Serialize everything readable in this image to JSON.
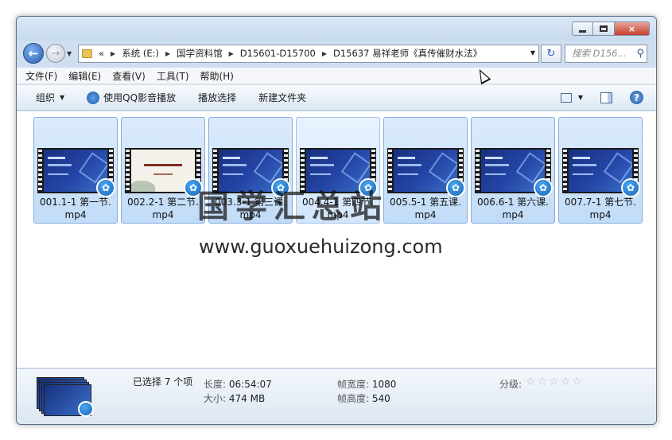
{
  "window": {
    "controls": {
      "minimize": "",
      "maximize": "",
      "close": "×"
    }
  },
  "nav": {
    "breadcrumb_prefix": "«",
    "breadcrumbs": [
      "系统 (E:)",
      "国学资料馆",
      "D15601-D15700",
      "D15637 易祥老师《真传催财水法》"
    ],
    "search_placeholder": "搜索 D156..."
  },
  "menu": [
    "文件(F)",
    "编辑(E)",
    "查看(V)",
    "工具(T)",
    "帮助(H)"
  ],
  "toolbar": {
    "organize": "组织",
    "play_qq": "使用QQ影音播放",
    "play_selection": "播放选择",
    "new_folder": "新建文件夹"
  },
  "files": [
    {
      "name": "001.1-1 第一节.mp4",
      "line1": "001.1-1 第一节.",
      "line2": "mp4",
      "thumb": "blue"
    },
    {
      "name": "002.2-1 第二节.mp4",
      "line1": "002.2-1 第二节.",
      "line2": "mp4",
      "thumb": "slide"
    },
    {
      "name": "003.3-1 第三课.mp4",
      "line1": "003.3-1 第三课.",
      "line2": "mp4",
      "thumb": "blue"
    },
    {
      "name": "004.4-1 第四节.mp4",
      "line1": "004.4-1 第四节.",
      "line2": "mp4",
      "thumb": "blue"
    },
    {
      "name": "005.5-1 第五课.mp4",
      "line1": "005.5-1 第五课.",
      "line2": "mp4",
      "thumb": "blue"
    },
    {
      "name": "006.6-1 第六课.mp4",
      "line1": "006.6-1 第六课.",
      "line2": "mp4",
      "thumb": "blue"
    },
    {
      "name": "007.7-1 第七节.mp4",
      "line1": "007.7-1 第七节.",
      "line2": "mp4",
      "thumb": "blue"
    }
  ],
  "watermark": {
    "cn": "国学汇总站",
    "url": "www.guoxuehuizong.com"
  },
  "details": {
    "selected": "已选择 7 个项",
    "length_label": "长度:",
    "length_value": "06:54:07",
    "size_label": "大小:",
    "size_value": "474 MB",
    "frame_width_label": "帧宽度:",
    "frame_width_value": "1080",
    "frame_height_label": "帧高度:",
    "frame_height_value": "540",
    "rating_label": "分级:",
    "rating_value": 0,
    "rating_max": 5
  },
  "colors": {
    "window_frame": "#cfdff0",
    "selection_fill": "#c1dcf8",
    "selection_border": "#84acdd",
    "accent": "#2b5fb0"
  }
}
